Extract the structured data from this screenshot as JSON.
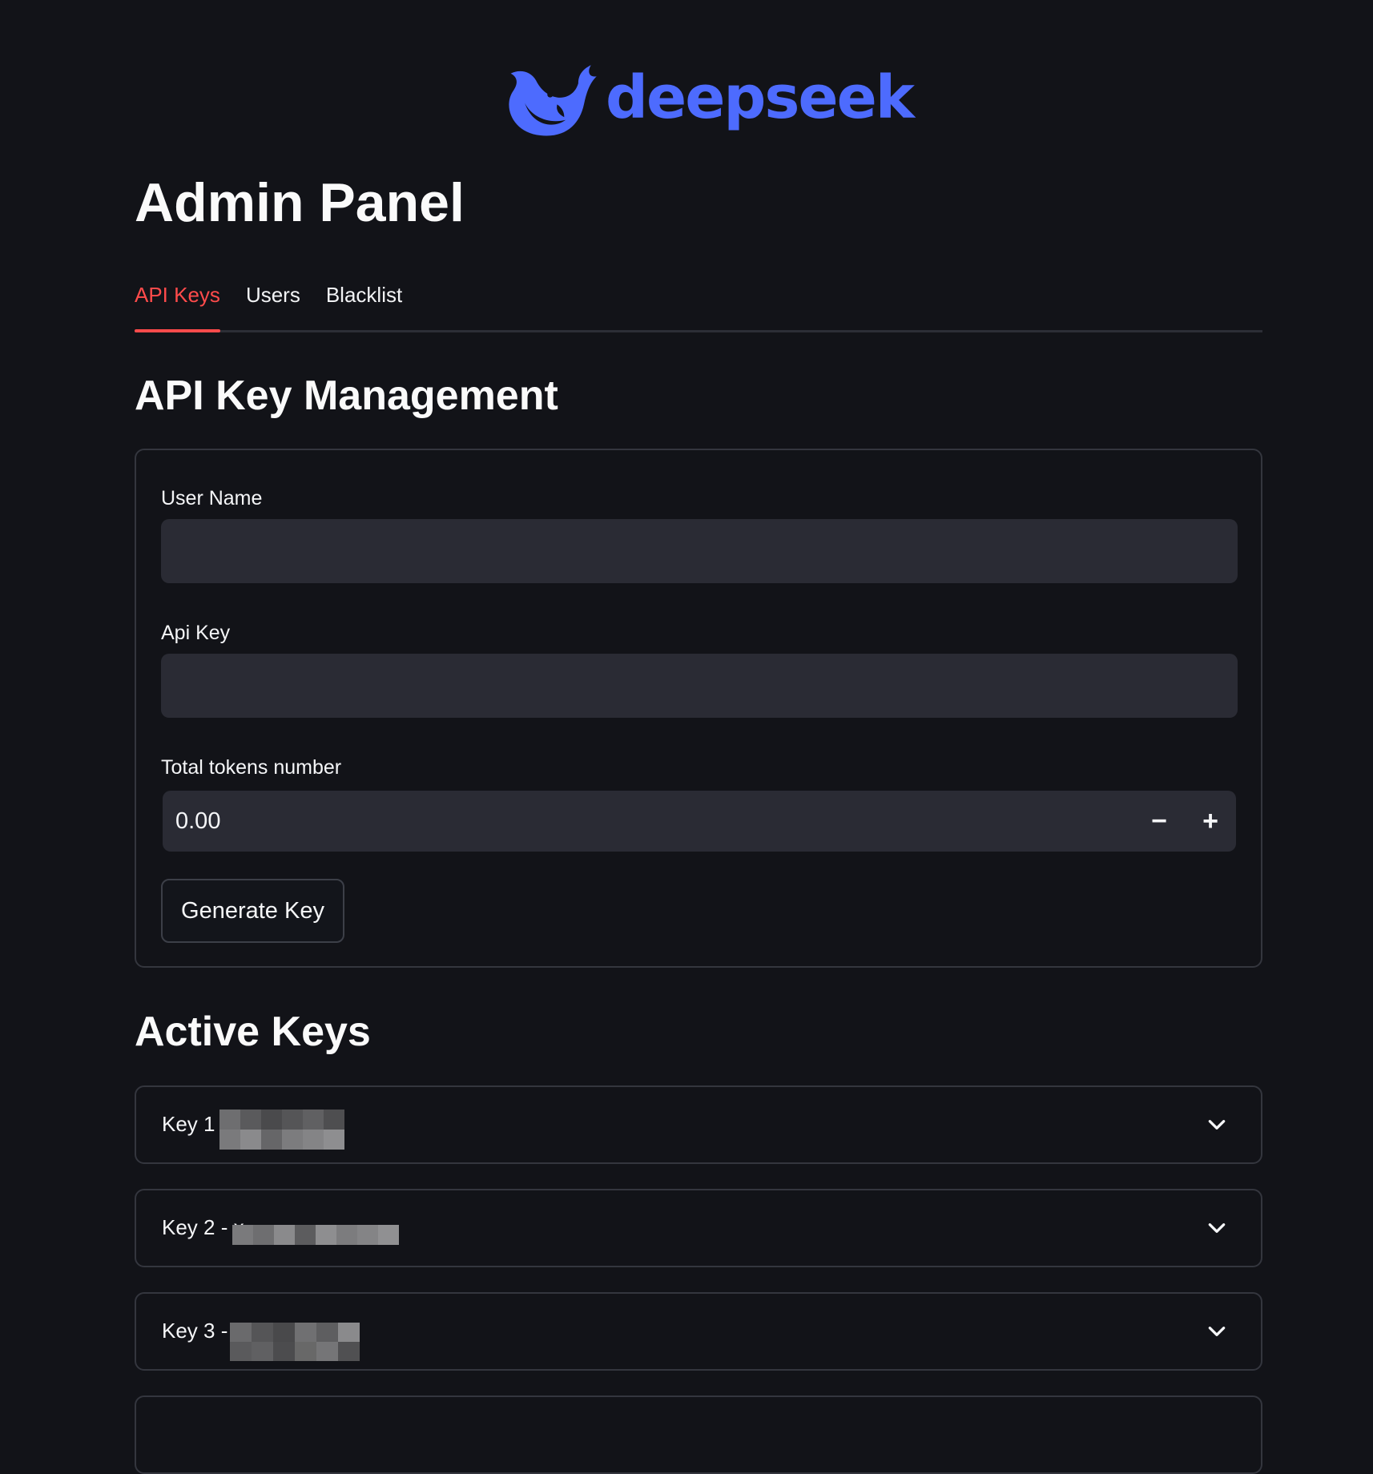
{
  "logo": {
    "text": "deepseek",
    "icon": "whale-icon",
    "color": "#4d6bfe"
  },
  "page_title": "Admin Panel",
  "tabs": [
    {
      "label": "API Keys",
      "active": true
    },
    {
      "label": "Users",
      "active": false
    },
    {
      "label": "Blacklist",
      "active": false
    }
  ],
  "management": {
    "title": "API Key Management",
    "user_name": {
      "label": "User Name",
      "value": "",
      "placeholder": ""
    },
    "api_key": {
      "label": "Api Key",
      "value": "",
      "placeholder": ""
    },
    "tokens": {
      "label": "Total tokens number",
      "value": "0.00",
      "decrement": "−",
      "increment": "+"
    },
    "generate_button": "Generate Key"
  },
  "active_keys": {
    "title": "Active Keys",
    "items": [
      {
        "label": "Key 1 -"
      },
      {
        "label": "Key 2 - x"
      },
      {
        "label": "Key 3 -"
      }
    ]
  },
  "colors": {
    "background": "#121318",
    "accent": "#ff4b4b",
    "input_bg": "#2a2b34",
    "border": "#34363e"
  }
}
